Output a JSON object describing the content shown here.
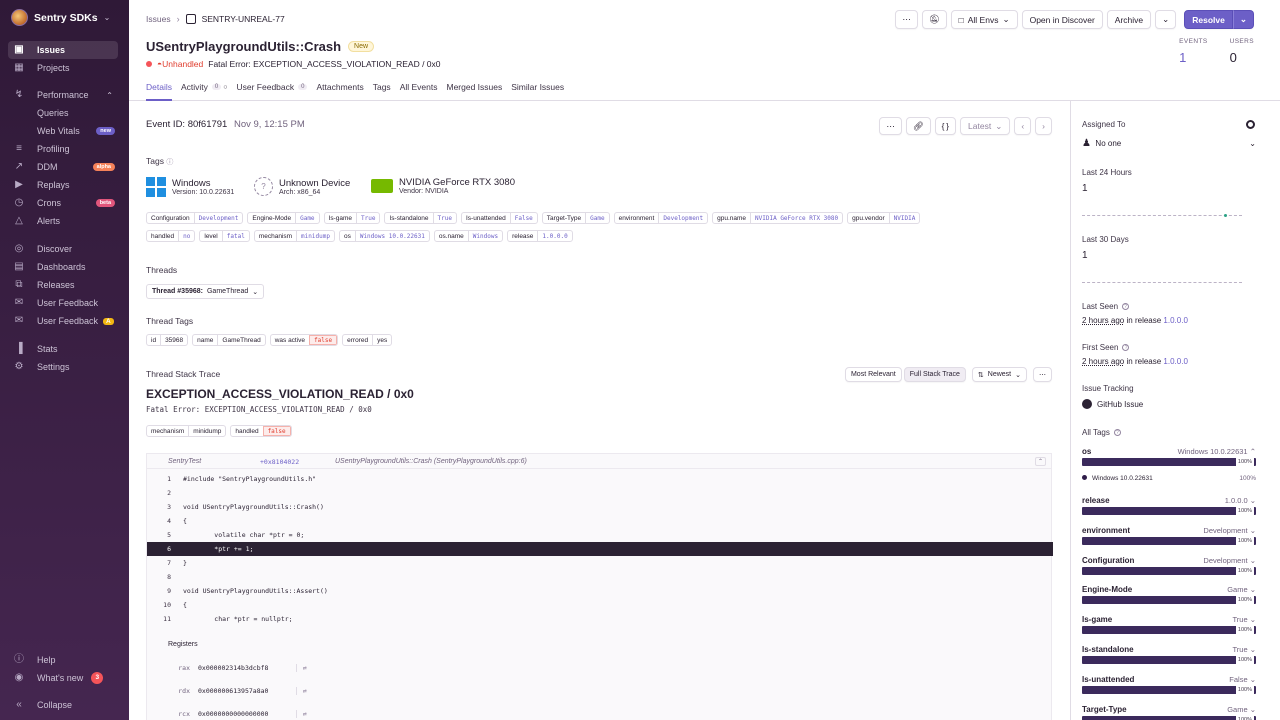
{
  "org": {
    "name": "Sentry SDKs"
  },
  "sidebar": {
    "items": [
      {
        "label": "Issues",
        "icon": "issues-icon",
        "active": true
      },
      {
        "label": "Projects",
        "icon": "projects-icon"
      },
      {
        "label": "Performance",
        "icon": "performance-icon"
      },
      {
        "label": "Queries",
        "sub": true
      },
      {
        "label": "Web Vitals",
        "sub": true,
        "badge": "new"
      },
      {
        "label": "Profiling",
        "icon": "profiling-icon"
      },
      {
        "label": "DDM",
        "icon": "ddm-icon",
        "badge": "alpha"
      },
      {
        "label": "Replays",
        "icon": "replays-icon"
      },
      {
        "label": "Crons",
        "icon": "crons-icon",
        "badge": "beta"
      },
      {
        "label": "Alerts",
        "icon": "alerts-icon"
      },
      {
        "label": "Discover",
        "icon": "discover-icon"
      },
      {
        "label": "Dashboards",
        "icon": "dashboards-icon"
      },
      {
        "label": "Releases",
        "icon": "releases-icon"
      },
      {
        "label": "User Feedback",
        "icon": "feedback-icon"
      },
      {
        "label": "User Feedback",
        "icon": "feedback-icon",
        "badge": "A"
      },
      {
        "label": "Stats",
        "icon": "stats-icon"
      },
      {
        "label": "Settings",
        "icon": "settings-icon"
      }
    ],
    "footer": [
      {
        "label": "Help",
        "icon": "help-icon"
      },
      {
        "label": "What's new",
        "icon": "broadcast-icon",
        "badge": "3"
      },
      {
        "label": "Collapse",
        "icon": "collapse-icon"
      }
    ]
  },
  "breadcrumb": {
    "root": "Issues",
    "current": "SENTRY-UNREAL-77"
  },
  "toolbar": {
    "envs": "All Envs",
    "discover": "Open in Discover",
    "archive": "Archive",
    "resolve": "Resolve"
  },
  "issue": {
    "title": "USentryPlaygroundUtils::Crash",
    "status_badge": "New",
    "handled": "Unhandled",
    "subtitle": "Fatal Error: EXCEPTION_ACCESS_VIOLATION_READ / 0x0"
  },
  "counters": {
    "events_label": "EVENTS",
    "events": "1",
    "users_label": "USERS",
    "users": "0"
  },
  "tabs": [
    {
      "label": "Details",
      "active": true
    },
    {
      "label": "Activity",
      "count": "0"
    },
    {
      "label": "User Feedback",
      "count": "0"
    },
    {
      "label": "Attachments"
    },
    {
      "label": "Tags"
    },
    {
      "label": "All Events"
    },
    {
      "label": "Merged Issues"
    },
    {
      "label": "Similar Issues"
    }
  ],
  "event": {
    "id_label": "Event ID:",
    "id": "80f61791",
    "date": "Nov 9, 12:15 PM",
    "latest": "Latest"
  },
  "tags_section": {
    "title": "Tags"
  },
  "contexts": [
    {
      "title": "Windows",
      "sub_label": "Version:",
      "sub": "10.0.22631"
    },
    {
      "title": "Unknown Device",
      "sub_label": "Arch:",
      "sub": "x86_64"
    },
    {
      "title": "NVIDIA GeForce RTX 3080",
      "sub_label": "Vendor:",
      "sub": "NVIDIA"
    }
  ],
  "tags_row1": [
    {
      "k": "Configuration",
      "v": "Development"
    },
    {
      "k": "Engine-Mode",
      "v": "Game"
    },
    {
      "k": "Is-game",
      "v": "True"
    },
    {
      "k": "Is-standalone",
      "v": "True"
    },
    {
      "k": "Is-unattended",
      "v": "False"
    },
    {
      "k": "Target-Type",
      "v": "Game"
    },
    {
      "k": "environment",
      "v": "Development"
    },
    {
      "k": "gpu.name",
      "v": "NVIDIA GeForce RTX 3080"
    },
    {
      "k": "gpu.vendor",
      "v": "NVIDIA"
    }
  ],
  "tags_row2": [
    {
      "k": "handled",
      "v": "no"
    },
    {
      "k": "level",
      "v": "fatal"
    },
    {
      "k": "mechanism",
      "v": "minidump"
    },
    {
      "k": "os",
      "v": "Windows 10.0.22631"
    },
    {
      "k": "os.name",
      "v": "Windows"
    },
    {
      "k": "release",
      "v": "1.0.0.0"
    }
  ],
  "threads": {
    "title": "Threads",
    "selector_label": "Thread #35968:",
    "selector_value": "GameThread"
  },
  "thread_tags": {
    "title": "Thread Tags",
    "items": [
      {
        "k": "id",
        "v": "35968"
      },
      {
        "k": "name",
        "v": "GameThread"
      },
      {
        "k": "was active",
        "v": "false"
      },
      {
        "k": "errored",
        "v": "yes"
      }
    ]
  },
  "stack": {
    "title": "Thread Stack Trace",
    "btn_relevant": "Most Relevant",
    "btn_full": "Full Stack Trace",
    "btn_sort": "Newest",
    "exception_type": "EXCEPTION_ACCESS_VIOLATION_READ / 0x0",
    "exception_value": "Fatal Error: EXCEPTION_ACCESS_VIOLATION_READ / 0x0",
    "mech_tags": [
      {
        "k": "mechanism",
        "v": "minidump"
      },
      {
        "k": "handled",
        "v": "false"
      }
    ],
    "frame": {
      "module": "SentryTest",
      "addr": "+0x8104022",
      "func": "USentryPlaygroundUtils::Crash (SentryPlaygroundUtils.cpp:6)"
    },
    "lines": [
      {
        "n": "1",
        "code": "#include \"SentryPlaygroundUtils.h\""
      },
      {
        "n": "2",
        "code": ""
      },
      {
        "n": "3",
        "code": "void USentryPlaygroundUtils::Crash()"
      },
      {
        "n": "4",
        "code": "{"
      },
      {
        "n": "5",
        "code": "        volatile char *ptr = 0;"
      },
      {
        "n": "6",
        "code": "        *ptr += 1;",
        "hl": true
      },
      {
        "n": "7",
        "code": "}"
      },
      {
        "n": "8",
        "code": ""
      },
      {
        "n": "9",
        "code": "void USentryPlaygroundUtils::Assert()"
      },
      {
        "n": "10",
        "code": "{"
      },
      {
        "n": "11",
        "code": "        char *ptr = nullptr;"
      }
    ],
    "registers_title": "Registers",
    "registers": [
      {
        "k": "rax",
        "v": "0x000002314b3dcbf8"
      },
      {
        "k": "rdx",
        "v": "0x000000613957a8a0"
      },
      {
        "k": "rcx",
        "v": "0x0000000000000000"
      }
    ]
  },
  "right": {
    "assigned_title": "Assigned To",
    "assigned_value": "No one",
    "last24_title": "Last 24 Hours",
    "last24_value": "1",
    "last30_title": "Last 30 Days",
    "last30_value": "1",
    "last_seen_title": "Last Seen",
    "last_seen_time": "2 hours ago",
    "last_seen_mid": "in release",
    "last_seen_release": "1.0.0.0",
    "first_seen_title": "First Seen",
    "first_seen_time": "2 hours ago",
    "first_seen_mid": "in release",
    "first_seen_release": "1.0.0.0",
    "tracking_title": "Issue Tracking",
    "tracking_item": "GitHub Issue",
    "all_tags_title": "All Tags",
    "os_tag": {
      "k": "os",
      "v": "Windows 10.0.22631",
      "pct": "100%",
      "legend": "Windows 10.0.22631",
      "legend_pct": "100%"
    },
    "tag_dist": [
      {
        "k": "release",
        "v": "1.0.0.0",
        "pct": "100%"
      },
      {
        "k": "environment",
        "v": "Development",
        "pct": "100%"
      },
      {
        "k": "Configuration",
        "v": "Development",
        "pct": "100%"
      },
      {
        "k": "Engine-Mode",
        "v": "Game",
        "pct": "100%"
      },
      {
        "k": "Is-game",
        "v": "True",
        "pct": "100%"
      },
      {
        "k": "Is-standalone",
        "v": "True",
        "pct": "100%"
      },
      {
        "k": "Is-unattended",
        "v": "False",
        "pct": "100%"
      },
      {
        "k": "Target-Type",
        "v": "Game",
        "pct": "100%"
      }
    ]
  },
  "colors": {
    "accent": "#6c5fc7",
    "sidebar": "#2f1937",
    "error": "#f55459"
  }
}
